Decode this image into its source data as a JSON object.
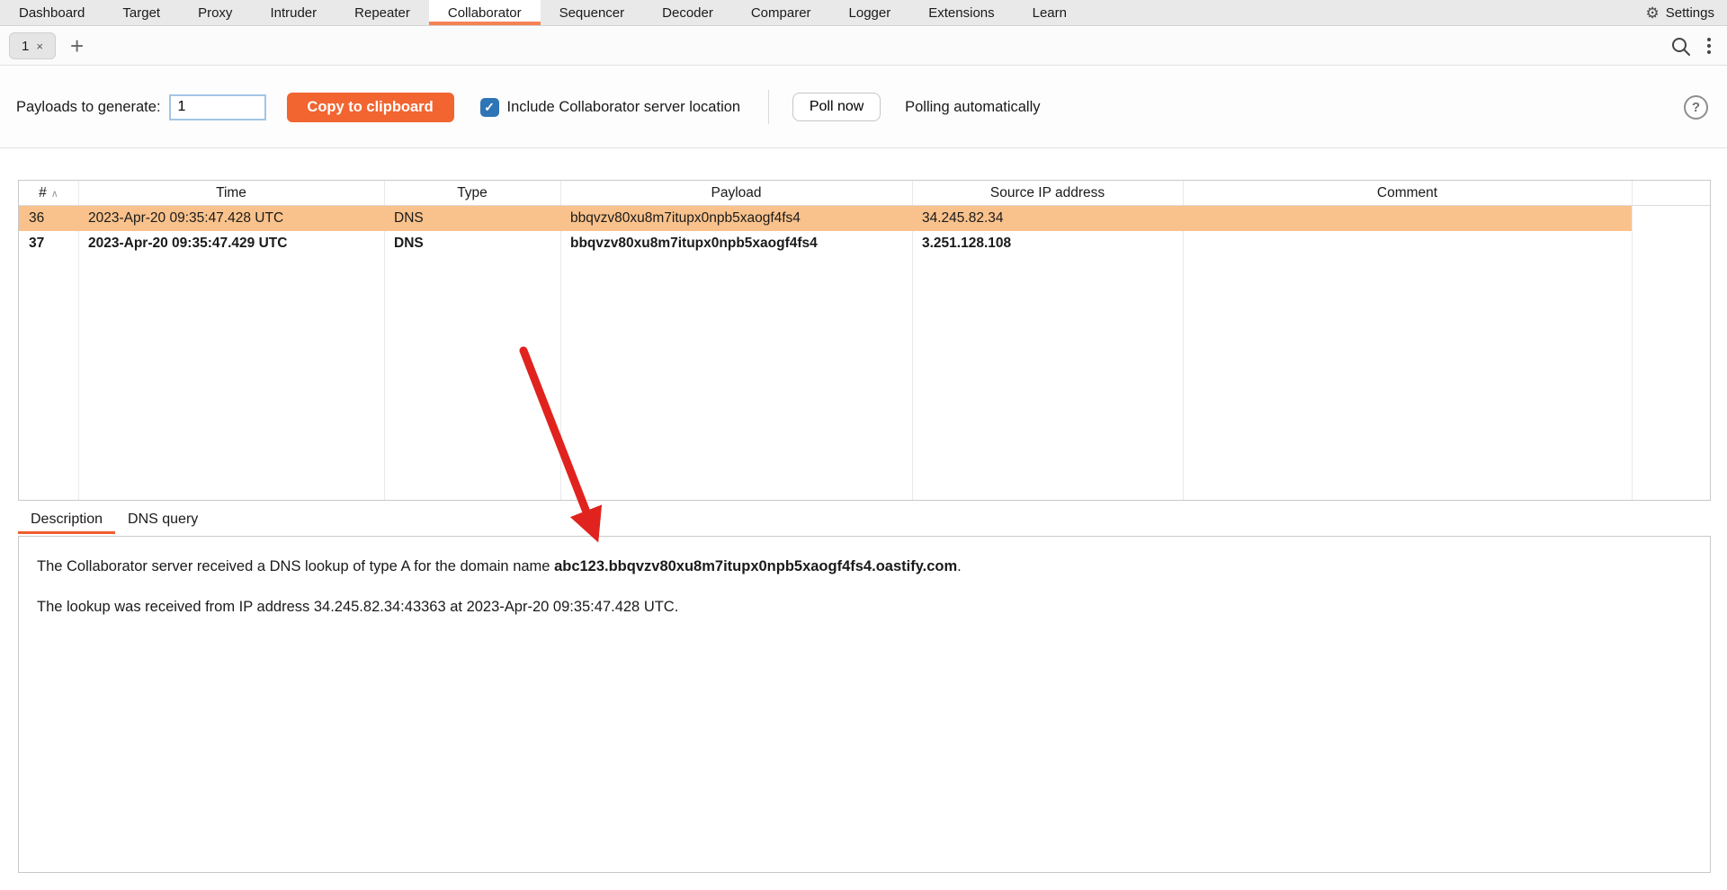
{
  "menubar": {
    "items": [
      "Dashboard",
      "Target",
      "Proxy",
      "Intruder",
      "Repeater",
      "Collaborator",
      "Sequencer",
      "Decoder",
      "Comparer",
      "Logger",
      "Extensions",
      "Learn"
    ],
    "selected_item": "Collaborator",
    "settings_label": "Settings"
  },
  "tabbar": {
    "tab_label": "1"
  },
  "icons": {
    "close": "×",
    "add_tab": "+",
    "settings_gear": "⚙",
    "help": "?",
    "checkbox_check": "✓",
    "sort_asc": "∧"
  },
  "toolbar": {
    "payloads_label": "Payloads to generate:",
    "payloads_value": "1",
    "copy_button_label": "Copy to clipboard",
    "include_location_label": "Include Collaborator server location",
    "include_location_checked": true,
    "poll_now_label": "Poll now",
    "polling_status": "Polling automatically"
  },
  "table": {
    "columns": [
      "#",
      "Time",
      "Type",
      "Payload",
      "Source IP address",
      "Comment"
    ],
    "sort_column": "#",
    "sort_direction": "ascending",
    "rows": [
      {
        "num": "36",
        "time": "2023-Apr-20 09:35:47.428 UTC",
        "type": "DNS",
        "payload": "bbqvzv80xu8m7itupx0npb5xaogf4fs4",
        "source_ip": "34.245.82.34",
        "comment": "",
        "selected": true
      },
      {
        "num": "37",
        "time": "2023-Apr-20 09:35:47.429 UTC",
        "type": "DNS",
        "payload": "bbqvzv80xu8m7itupx0npb5xaogf4fs4",
        "source_ip": "3.251.128.108",
        "comment": "",
        "unread": true
      }
    ]
  },
  "detail": {
    "tabs": [
      {
        "label": "Description",
        "selected": true
      },
      {
        "label": "DNS query",
        "selected": false
      }
    ],
    "description": {
      "line1_prefix": "The Collaborator server received a DNS lookup of type A for the domain name ",
      "line1_domain": "abc123.bbqvzv80xu8m7itupx0npb5xaogf4fs4.oastify.com",
      "line1_suffix": ".",
      "line2": "The lookup was received from IP address 34.245.82.34:43363 at 2023-Apr-20 09:35:47.428 UTC."
    }
  },
  "colors": {
    "accent_orange": "#f26430",
    "menu_underline_orange": "#f58253",
    "selected_row_orange": "#f9c28c",
    "checkbox_blue": "#2e75b6",
    "arrow_red": "#e0231e"
  }
}
